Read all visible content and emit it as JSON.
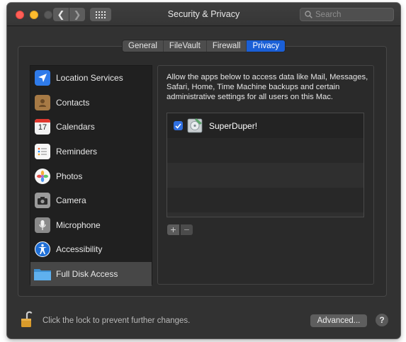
{
  "window": {
    "title": "Security & Privacy",
    "search_placeholder": "Search"
  },
  "tabs": [
    {
      "label": "General",
      "active": false
    },
    {
      "label": "FileVault",
      "active": false
    },
    {
      "label": "Firewall",
      "active": false
    },
    {
      "label": "Privacy",
      "active": true
    }
  ],
  "sidebar": {
    "items": [
      {
        "label": "Location Services",
        "icon": "location-arrow-icon"
      },
      {
        "label": "Contacts",
        "icon": "contacts-book-icon"
      },
      {
        "label": "Calendars",
        "icon": "calendar-icon",
        "icon_text": "17"
      },
      {
        "label": "Reminders",
        "icon": "reminders-list-icon"
      },
      {
        "label": "Photos",
        "icon": "photos-flower-icon"
      },
      {
        "label": "Camera",
        "icon": "camera-icon"
      },
      {
        "label": "Microphone",
        "icon": "microphone-icon"
      },
      {
        "label": "Accessibility",
        "icon": "accessibility-icon"
      },
      {
        "label": "Full Disk Access",
        "icon": "folder-icon",
        "selected": true
      }
    ]
  },
  "main": {
    "description": "Allow the apps below to access data like Mail, Messages, Safari, Home, Time Machine backups and certain administrative settings for all users on this Mac.",
    "apps": [
      {
        "name": "SuperDuper!",
        "checked": true,
        "icon": "superduper-disk-icon"
      }
    ],
    "add_label": "+",
    "remove_label": "−"
  },
  "footer": {
    "lock_text": "Click the lock to prevent further changes.",
    "advanced_label": "Advanced...",
    "help_label": "?"
  },
  "colors": {
    "accent": "#1a5fd6",
    "checkbox": "#2f6fe0",
    "window_bg": "#323232"
  }
}
